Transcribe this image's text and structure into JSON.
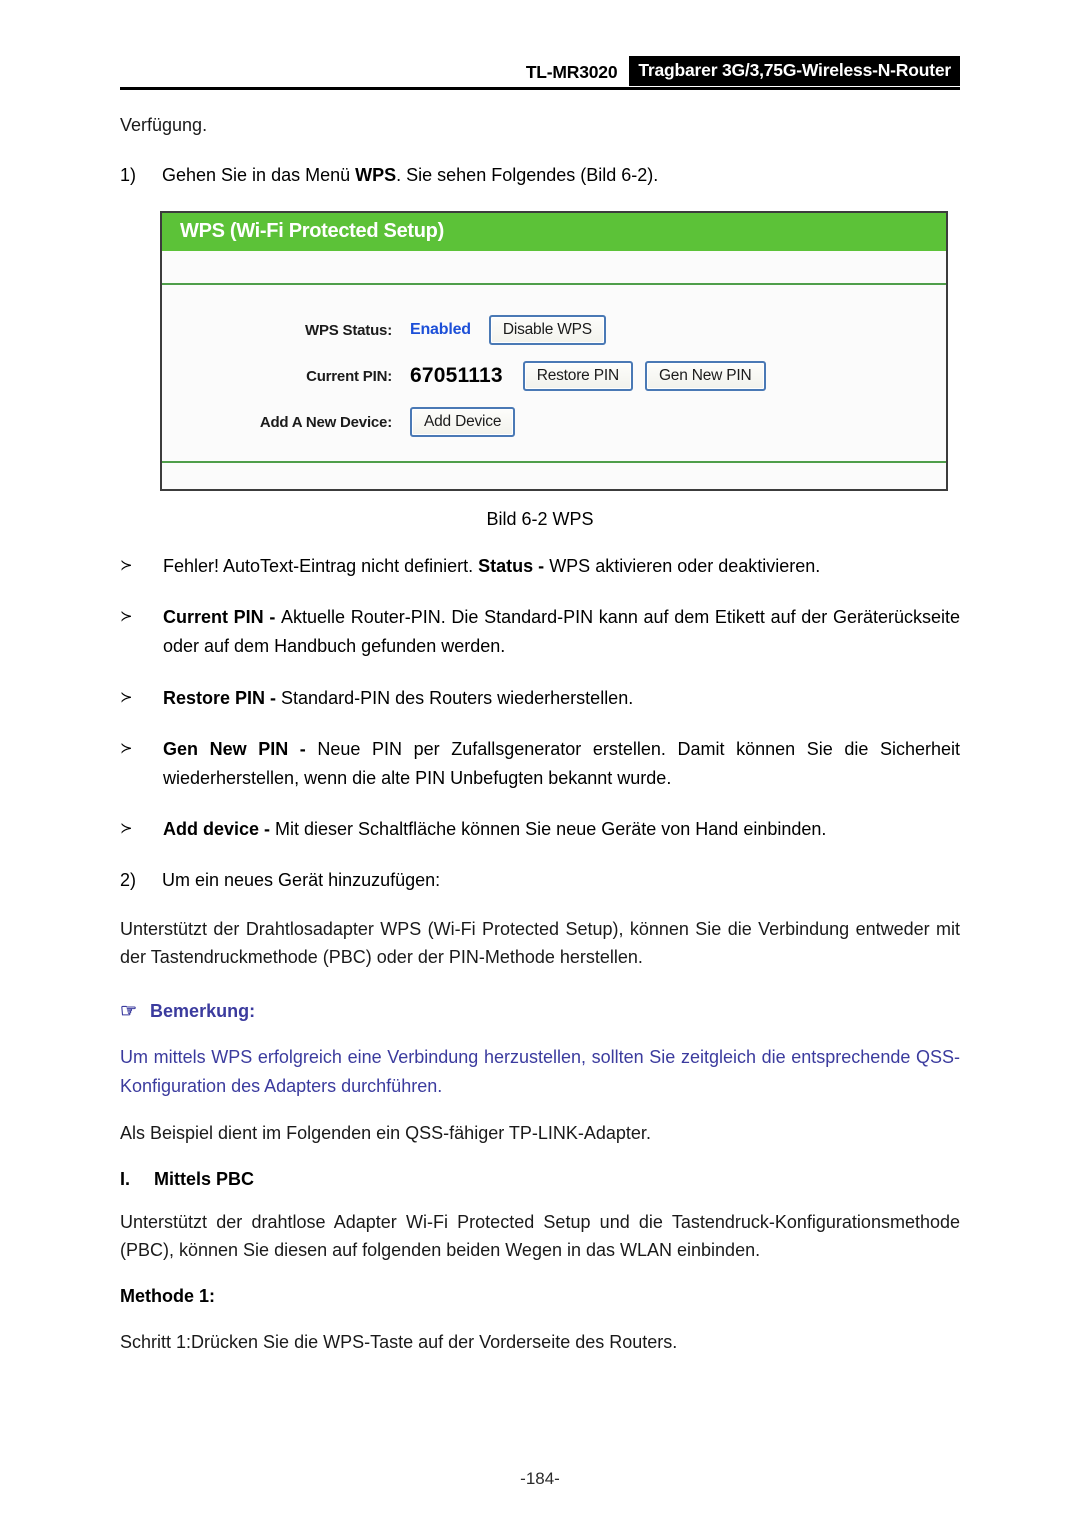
{
  "header": {
    "model": "TL-MR3020",
    "product": "Tragbarer 3G/3,75G-Wireless-N-Router"
  },
  "body": {
    "lead": "Verfügung.",
    "step1": {
      "num": "1)",
      "text_before": "Gehen Sie in das Menü ",
      "bold": "WPS",
      "text_after": ". Sie sehen Folgendes (Bild 6-2)."
    },
    "caption": "Bild 6-2 WPS",
    "bullet_marker": "≻",
    "bullets": [
      {
        "lead": "Fehler! AutoText-Eintrag nicht definiert. ",
        "bold": "Status - ",
        "rest": "WPS aktivieren oder deaktivieren."
      },
      {
        "lead": "",
        "bold": "Current PIN - ",
        "rest": "Aktuelle Router-PIN. Die Standard-PIN kann auf dem Etikett auf der Geräterückseite oder auf dem Handbuch gefunden werden."
      },
      {
        "lead": "",
        "bold": "Restore PIN - ",
        "rest": "Standard-PIN des Routers wiederherstellen."
      },
      {
        "lead": "",
        "bold": "Gen New PIN - ",
        "rest": "Neue PIN per Zufallsgenerator erstellen. Damit können Sie die Sicherheit wiederherstellen, wenn die alte PIN Unbefugten bekannt wurde."
      },
      {
        "lead": "",
        "bold": "Add device - ",
        "rest": "Mit dieser Schaltfläche können Sie neue Geräte von Hand einbinden."
      }
    ],
    "step2": {
      "num": "2)",
      "text": "Um ein neues Gerät hinzuzufügen:"
    },
    "para_pbc_pin": "Unterstützt der Drahtlosadapter WPS (Wi-Fi Protected Setup), können Sie die Verbindung entweder mit der Tastendruckmethode (PBC) oder der PIN-Methode herstellen.",
    "note": {
      "icon": "☞",
      "title": "Bemerkung:",
      "text": "Um mittels WPS erfolgreich eine Verbindung herzustellen, sollten Sie zeitgleich die entsprechende QSS-Konfiguration des Adapters durchführen.",
      "color": "#3b3b9e"
    },
    "para_example": "Als Beispiel dient im Folgenden ein QSS-fähiger TP-LINK-Adapter.",
    "section_pbc": {
      "numeral": "I.",
      "title": "Mittels PBC"
    },
    "para_pbc": "Unterstützt der drahtlose Adapter Wi-Fi Protected Setup und die Tastendruck-Konfigurationsmethode (PBC), können Sie diesen auf folgenden beiden Wegen in das WLAN einbinden.",
    "method_heading": "Methode 1:",
    "step_line": "Schritt 1:Drücken Sie die WPS-Taste auf der Vorderseite des Routers."
  },
  "screenshot": {
    "title": "WPS (Wi-Fi Protected Setup)",
    "title_bg": "#5cc238",
    "rows": [
      {
        "label": "WPS Status:",
        "value": "Enabled",
        "value_color": "#1c4fd8",
        "buttons": [
          "Disable WPS"
        ]
      },
      {
        "label": "Current PIN:",
        "value": "67051113",
        "buttons": [
          "Restore PIN",
          "Gen New PIN"
        ]
      },
      {
        "label": "Add A New Device:",
        "value": "",
        "buttons": [
          "Add Device"
        ]
      }
    ]
  },
  "footer": {
    "page_number": "-184-"
  }
}
